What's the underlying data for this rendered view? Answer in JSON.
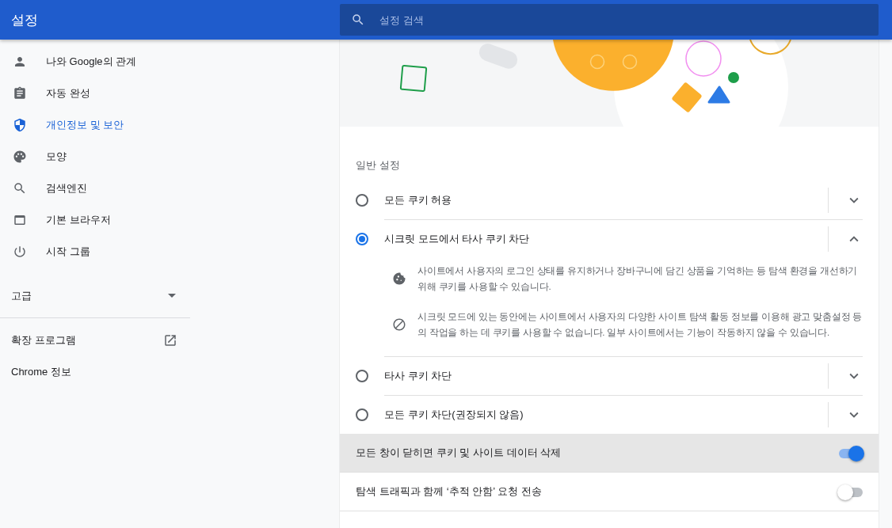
{
  "header": {
    "title": "설정",
    "search": {
      "placeholder": "설정 검색"
    }
  },
  "sidebar": {
    "items": [
      {
        "label": "나와 Google의 관계",
        "selected": false
      },
      {
        "label": "자동 완성",
        "selected": false
      },
      {
        "label": "개인정보 및 보안",
        "selected": true
      },
      {
        "label": "모양",
        "selected": false
      },
      {
        "label": "검색엔진",
        "selected": false
      },
      {
        "label": "기본 브라우저",
        "selected": false
      },
      {
        "label": "시작 그룹",
        "selected": false
      }
    ],
    "advanced": {
      "label": "고급",
      "expanded": false
    },
    "links": [
      {
        "label": "확장 프로그램",
        "kind": "external"
      },
      {
        "label": "Chrome 정보",
        "kind": "plain"
      }
    ]
  },
  "section": {
    "title": "일반 설정",
    "options": [
      {
        "label": "모든 쿠키 허용",
        "selected": false,
        "expanded": false
      },
      {
        "label": "시크릿 모드에서 타사 쿠키 차단",
        "selected": true,
        "expanded": true,
        "details": [
          "사이트에서 사용자의 로그인 상태를 유지하거나 장바구니에 담긴 상품을 기억하는 등 탐색 환경을 개선하기 위해 쿠키를 사용할 수 있습니다.",
          "시크릿 모드에 있는 동안에는 사이트에서 사용자의 다양한 사이트 탐색 활동 정보를 이용해 광고 맞춤설정 등의 작업을 하는 데 쿠키를 사용할 수 없습니다. 일부 사이트에서는 기능이 작동하지 않을 수 있습니다."
        ]
      },
      {
        "label": "타사 쿠키 차단",
        "selected": false,
        "expanded": false
      },
      {
        "label": "모든 쿠키 차단(권장되지 않음)",
        "selected": false,
        "expanded": false
      }
    ],
    "toggles": [
      {
        "label": "모든 창이 닫히면 쿠키 및 사이트 데이터 삭제",
        "on": true,
        "highlighted": true
      },
      {
        "label": "탐색 트래픽과 함께 ‘추적 안함’ 요청 전송",
        "on": false,
        "highlighted": false
      }
    ]
  }
}
